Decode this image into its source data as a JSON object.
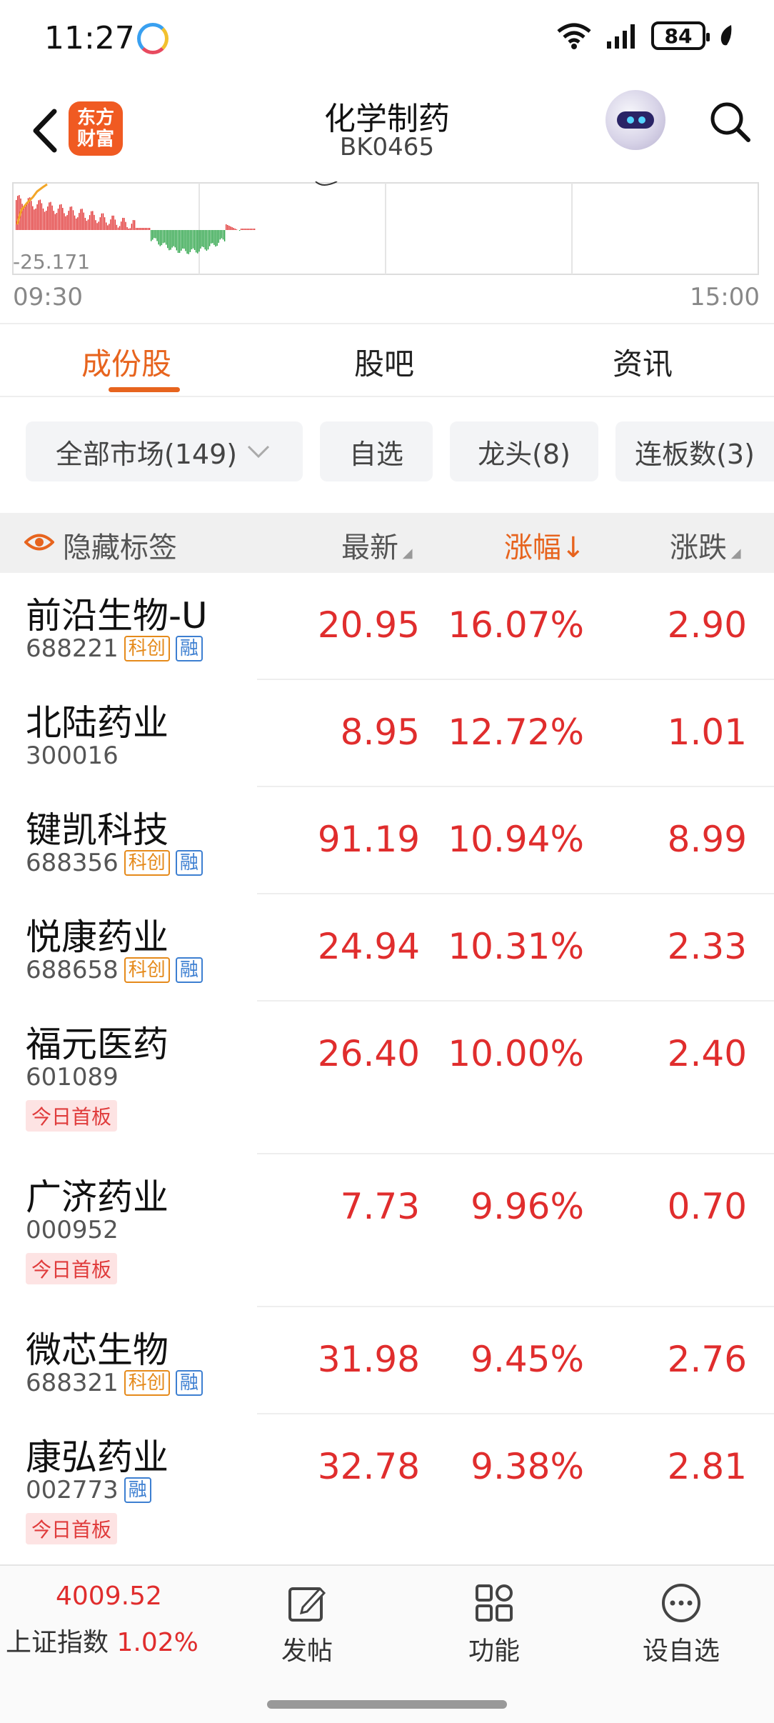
{
  "status_bar": {
    "time": "11:27",
    "battery": "84"
  },
  "header": {
    "logo_text": "东方\n财富",
    "title": "化学制药",
    "code": "BK0465"
  },
  "minichart": {
    "low_value": "-25.171",
    "start_time": "09:30",
    "end_time": "15:00"
  },
  "tabs": [
    {
      "label": "成份股",
      "active": true
    },
    {
      "label": "股吧",
      "active": false
    },
    {
      "label": "资讯",
      "active": false
    }
  ],
  "filters": {
    "market": "全部市场(149)",
    "chips": [
      "自选",
      "龙头(8)",
      "连板数(3)"
    ]
  },
  "table_header": {
    "hide_tags": "隐藏标签",
    "latest": "最新",
    "change_pct": "涨幅↓",
    "change": "涨跌"
  },
  "rows": [
    {
      "name": "前沿生物-U",
      "code": "688221",
      "kc": "科创",
      "rong": "融",
      "badge": "",
      "latest": "20.95",
      "pct": "16.07%",
      "chg": "2.90"
    },
    {
      "name": "北陆药业",
      "code": "300016",
      "kc": "",
      "rong": "",
      "badge": "",
      "latest": "8.95",
      "pct": "12.72%",
      "chg": "1.01"
    },
    {
      "name": "键凯科技",
      "code": "688356",
      "kc": "科创",
      "rong": "融",
      "badge": "",
      "latest": "91.19",
      "pct": "10.94%",
      "chg": "8.99"
    },
    {
      "name": "悦康药业",
      "code": "688658",
      "kc": "科创",
      "rong": "融",
      "badge": "",
      "latest": "24.94",
      "pct": "10.31%",
      "chg": "2.33"
    },
    {
      "name": "福元医药",
      "code": "601089",
      "kc": "",
      "rong": "",
      "badge": "今日首板",
      "latest": "26.40",
      "pct": "10.00%",
      "chg": "2.40"
    },
    {
      "name": "广济药业",
      "code": "000952",
      "kc": "",
      "rong": "",
      "badge": "今日首板",
      "latest": "7.73",
      "pct": "9.96%",
      "chg": "0.70"
    },
    {
      "name": "微芯生物",
      "code": "688321",
      "kc": "科创",
      "rong": "融",
      "badge": "",
      "latest": "31.98",
      "pct": "9.45%",
      "chg": "2.76"
    },
    {
      "name": "康弘药业",
      "code": "002773",
      "kc": "",
      "rong": "融",
      "badge": "今日首板",
      "latest": "32.78",
      "pct": "9.38%",
      "chg": "2.81"
    }
  ],
  "bottom_bar": {
    "index_value": "4009.52",
    "index_name": "上证指数",
    "index_pct": "1.02%",
    "nav": [
      {
        "label": "发帖",
        "icon": "edit-icon"
      },
      {
        "label": "功能",
        "icon": "apps-icon"
      },
      {
        "label": "设自选",
        "icon": "more-icon"
      }
    ]
  },
  "colors": {
    "accent": "#e7641e",
    "up": "#e02d2d",
    "down": "#1e9e3c"
  }
}
